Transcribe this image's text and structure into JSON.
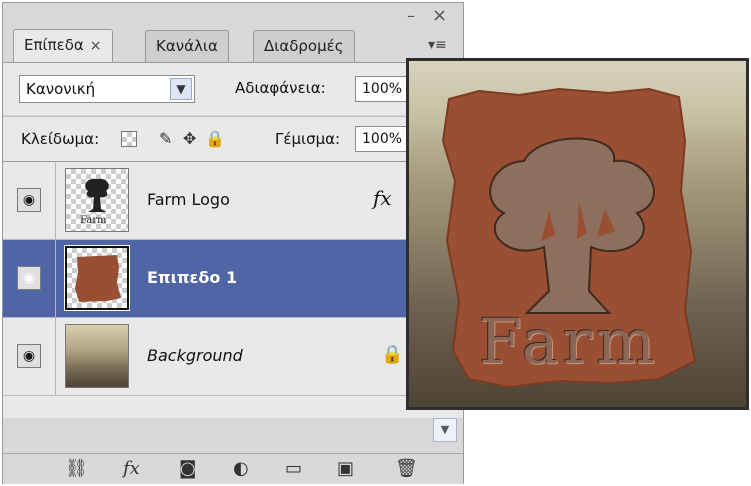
{
  "tabs": [
    {
      "label": "Επίπεδα",
      "close": "×",
      "active": true
    },
    {
      "label": "Κανάλια",
      "active": false
    },
    {
      "label": "Διαδρομές",
      "active": false
    }
  ],
  "window": {
    "minimize": "–",
    "close": "×",
    "menu": "▾≡"
  },
  "options": {
    "blend_mode": "Κανονική",
    "opacity_label": "Αδιαφάνεια:",
    "opacity_value": "100%",
    "lock_label": "Κλείδωμα:",
    "fill_label": "Γέμισμα:",
    "fill_value": "100%"
  },
  "layers": [
    {
      "name": "Farm Logo",
      "visible": true,
      "has_fx": true,
      "fx_label": "fx",
      "selected": false
    },
    {
      "name": "Επιπεδο 1",
      "visible": true,
      "selected": true
    },
    {
      "name": "Background",
      "visible": true,
      "locked": true,
      "selected": false
    }
  ],
  "footer_icons": [
    "link-icon",
    "fx-icon",
    "mask-icon",
    "adjustment-icon",
    "folder-icon",
    "new-layer-icon",
    "trash-icon"
  ],
  "preview": {
    "text": "Farm"
  },
  "colors": {
    "selection": "#4f65a5",
    "shape": "#9a4e32",
    "panel": "#e9e9e9"
  }
}
